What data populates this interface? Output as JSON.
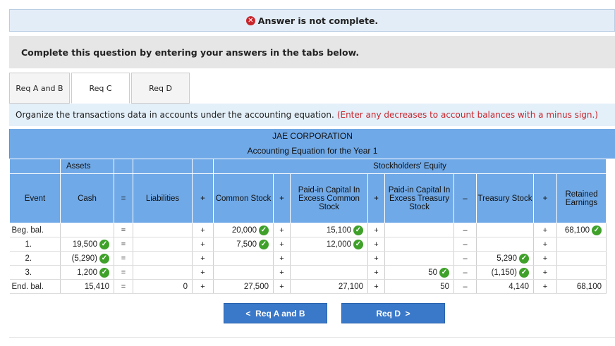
{
  "banner": {
    "icon": "x-circle-icon",
    "message": "Answer is not complete."
  },
  "instruction": "Complete this question by entering your answers in the tabs below.",
  "tabs": [
    {
      "label": "Req A and B",
      "active": false
    },
    {
      "label": "Req C",
      "active": true
    },
    {
      "label": "Req D",
      "active": false
    }
  ],
  "organize": {
    "text": "Organize the transactions data in accounts under the accounting equation.",
    "note": "(Enter any decreases to account balances with a minus sign.)"
  },
  "table": {
    "company": "JAE CORPORATION",
    "subtitle": "Accounting Equation for the Year 1",
    "groups": {
      "assets": "Assets",
      "equity": "Stockholders' Equity"
    },
    "headers": {
      "event": "Event",
      "cash": "Cash",
      "eq": "=",
      "liabilities": "Liabilities",
      "plus": "+",
      "common_stock": "Common Stock",
      "paid_in_common": "Paid-in Capital In Excess Common Stock",
      "paid_in_treasury": "Paid-in Capital In Excess Treasury Stock",
      "minus": "–",
      "treasury_stock": "Treasury Stock",
      "retained_earnings": "Retained Earnings"
    },
    "rows": [
      {
        "event": "Beg. bal.",
        "cash": "",
        "liab": "",
        "cs": "20,000",
        "pic": "15,100",
        "pit": "",
        "ts": "",
        "re": "68,100",
        "cash_ok": false,
        "cs_ok": true,
        "pic_ok": true,
        "pit_ok": false,
        "ts_ok": false,
        "re_ok": true
      },
      {
        "event": "1.",
        "cash": "19,500",
        "liab": "",
        "cs": "7,500",
        "pic": "12,000",
        "pit": "",
        "ts": "",
        "re": "",
        "cash_ok": true,
        "cs_ok": true,
        "pic_ok": true,
        "pit_ok": false,
        "ts_ok": false,
        "re_ok": false
      },
      {
        "event": "2.",
        "cash": "(5,290)",
        "liab": "",
        "cs": "",
        "pic": "",
        "pit": "",
        "ts": "5,290",
        "re": "",
        "cash_ok": true,
        "cs_ok": false,
        "pic_ok": false,
        "pit_ok": false,
        "ts_ok": true,
        "re_ok": false
      },
      {
        "event": "3.",
        "cash": "1,200",
        "liab": "",
        "cs": "",
        "pic": "",
        "pit": "50",
        "ts": "(1,150)",
        "re": "",
        "cash_ok": true,
        "cs_ok": false,
        "pic_ok": false,
        "pit_ok": true,
        "ts_ok": true,
        "re_ok": false
      },
      {
        "event": "End. bal.",
        "cash": "15,410",
        "liab": "0",
        "cs": "27,500",
        "pic": "27,100",
        "pit": "50",
        "ts": "4,140",
        "re": "68,100",
        "cash_ok": false,
        "cs_ok": false,
        "pic_ok": false,
        "pit_ok": false,
        "ts_ok": false,
        "re_ok": false
      }
    ]
  },
  "nav": {
    "prev": "Req A and B",
    "next": "Req D"
  },
  "colors": {
    "header_blue": "#70a9e7",
    "button_blue": "#3a78c9",
    "check_green": "#3fa12a",
    "error_red": "#c8252c"
  }
}
